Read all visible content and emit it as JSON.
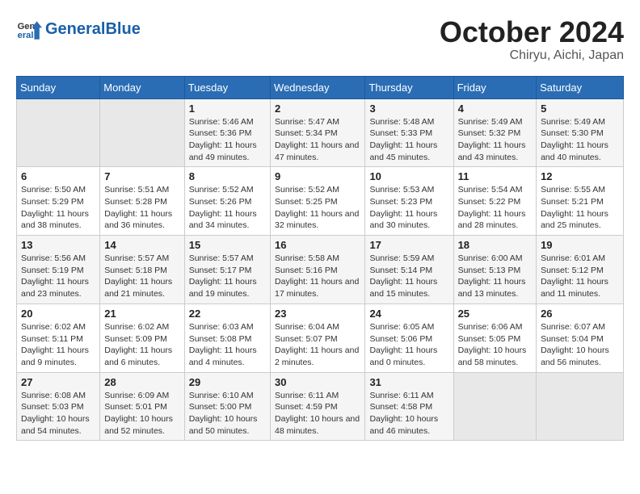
{
  "header": {
    "logo_general": "General",
    "logo_blue": "Blue",
    "month": "October 2024",
    "location": "Chiryu, Aichi, Japan"
  },
  "days_of_week": [
    "Sunday",
    "Monday",
    "Tuesday",
    "Wednesday",
    "Thursday",
    "Friday",
    "Saturday"
  ],
  "weeks": [
    [
      {
        "day": "",
        "info": ""
      },
      {
        "day": "",
        "info": ""
      },
      {
        "day": "1",
        "info": "Sunrise: 5:46 AM\nSunset: 5:36 PM\nDaylight: 11 hours and 49 minutes."
      },
      {
        "day": "2",
        "info": "Sunrise: 5:47 AM\nSunset: 5:34 PM\nDaylight: 11 hours and 47 minutes."
      },
      {
        "day": "3",
        "info": "Sunrise: 5:48 AM\nSunset: 5:33 PM\nDaylight: 11 hours and 45 minutes."
      },
      {
        "day": "4",
        "info": "Sunrise: 5:49 AM\nSunset: 5:32 PM\nDaylight: 11 hours and 43 minutes."
      },
      {
        "day": "5",
        "info": "Sunrise: 5:49 AM\nSunset: 5:30 PM\nDaylight: 11 hours and 40 minutes."
      }
    ],
    [
      {
        "day": "6",
        "info": "Sunrise: 5:50 AM\nSunset: 5:29 PM\nDaylight: 11 hours and 38 minutes."
      },
      {
        "day": "7",
        "info": "Sunrise: 5:51 AM\nSunset: 5:28 PM\nDaylight: 11 hours and 36 minutes."
      },
      {
        "day": "8",
        "info": "Sunrise: 5:52 AM\nSunset: 5:26 PM\nDaylight: 11 hours and 34 minutes."
      },
      {
        "day": "9",
        "info": "Sunrise: 5:52 AM\nSunset: 5:25 PM\nDaylight: 11 hours and 32 minutes."
      },
      {
        "day": "10",
        "info": "Sunrise: 5:53 AM\nSunset: 5:23 PM\nDaylight: 11 hours and 30 minutes."
      },
      {
        "day": "11",
        "info": "Sunrise: 5:54 AM\nSunset: 5:22 PM\nDaylight: 11 hours and 28 minutes."
      },
      {
        "day": "12",
        "info": "Sunrise: 5:55 AM\nSunset: 5:21 PM\nDaylight: 11 hours and 25 minutes."
      }
    ],
    [
      {
        "day": "13",
        "info": "Sunrise: 5:56 AM\nSunset: 5:19 PM\nDaylight: 11 hours and 23 minutes."
      },
      {
        "day": "14",
        "info": "Sunrise: 5:57 AM\nSunset: 5:18 PM\nDaylight: 11 hours and 21 minutes."
      },
      {
        "day": "15",
        "info": "Sunrise: 5:57 AM\nSunset: 5:17 PM\nDaylight: 11 hours and 19 minutes."
      },
      {
        "day": "16",
        "info": "Sunrise: 5:58 AM\nSunset: 5:16 PM\nDaylight: 11 hours and 17 minutes."
      },
      {
        "day": "17",
        "info": "Sunrise: 5:59 AM\nSunset: 5:14 PM\nDaylight: 11 hours and 15 minutes."
      },
      {
        "day": "18",
        "info": "Sunrise: 6:00 AM\nSunset: 5:13 PM\nDaylight: 11 hours and 13 minutes."
      },
      {
        "day": "19",
        "info": "Sunrise: 6:01 AM\nSunset: 5:12 PM\nDaylight: 11 hours and 11 minutes."
      }
    ],
    [
      {
        "day": "20",
        "info": "Sunrise: 6:02 AM\nSunset: 5:11 PM\nDaylight: 11 hours and 9 minutes."
      },
      {
        "day": "21",
        "info": "Sunrise: 6:02 AM\nSunset: 5:09 PM\nDaylight: 11 hours and 6 minutes."
      },
      {
        "day": "22",
        "info": "Sunrise: 6:03 AM\nSunset: 5:08 PM\nDaylight: 11 hours and 4 minutes."
      },
      {
        "day": "23",
        "info": "Sunrise: 6:04 AM\nSunset: 5:07 PM\nDaylight: 11 hours and 2 minutes."
      },
      {
        "day": "24",
        "info": "Sunrise: 6:05 AM\nSunset: 5:06 PM\nDaylight: 11 hours and 0 minutes."
      },
      {
        "day": "25",
        "info": "Sunrise: 6:06 AM\nSunset: 5:05 PM\nDaylight: 10 hours and 58 minutes."
      },
      {
        "day": "26",
        "info": "Sunrise: 6:07 AM\nSunset: 5:04 PM\nDaylight: 10 hours and 56 minutes."
      }
    ],
    [
      {
        "day": "27",
        "info": "Sunrise: 6:08 AM\nSunset: 5:03 PM\nDaylight: 10 hours and 54 minutes."
      },
      {
        "day": "28",
        "info": "Sunrise: 6:09 AM\nSunset: 5:01 PM\nDaylight: 10 hours and 52 minutes."
      },
      {
        "day": "29",
        "info": "Sunrise: 6:10 AM\nSunset: 5:00 PM\nDaylight: 10 hours and 50 minutes."
      },
      {
        "day": "30",
        "info": "Sunrise: 6:11 AM\nSunset: 4:59 PM\nDaylight: 10 hours and 48 minutes."
      },
      {
        "day": "31",
        "info": "Sunrise: 6:11 AM\nSunset: 4:58 PM\nDaylight: 10 hours and 46 minutes."
      },
      {
        "day": "",
        "info": ""
      },
      {
        "day": "",
        "info": ""
      }
    ]
  ]
}
